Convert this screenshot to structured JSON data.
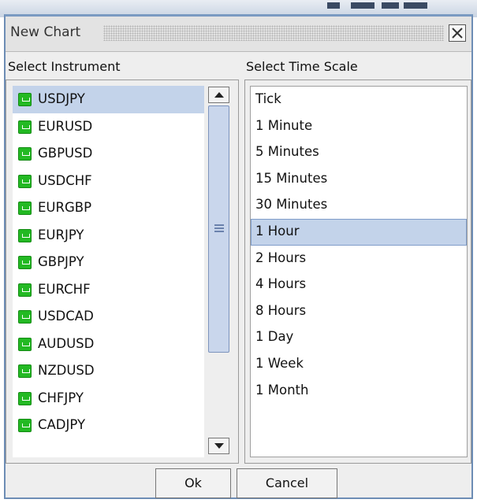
{
  "window": {
    "title": "New Chart"
  },
  "instruments": {
    "header": "Select Instrument",
    "items": [
      "USDJPY",
      "EURUSD",
      "GBPUSD",
      "USDCHF",
      "EURGBP",
      "EURJPY",
      "GBPJPY",
      "EURCHF",
      "USDCAD",
      "AUDUSD",
      "NZDUSD",
      "CHFJPY",
      "CADJPY"
    ],
    "selected": "USDJPY",
    "icon": "instrument-icon"
  },
  "time_scale": {
    "header": "Select Time Scale",
    "items": [
      "Tick",
      "1 Minute",
      "5 Minutes",
      "15 Minutes",
      "30 Minutes",
      "1 Hour",
      "2 Hours",
      "4 Hours",
      "8 Hours",
      "1 Day",
      "1 Week",
      "1 Month"
    ],
    "selected": "1 Hour"
  },
  "buttons": {
    "ok": "Ok",
    "cancel": "Cancel"
  },
  "colors": {
    "selection": "#c3d3ea",
    "window_border": "#6d8db5",
    "instrument_icon": "#23b923"
  }
}
